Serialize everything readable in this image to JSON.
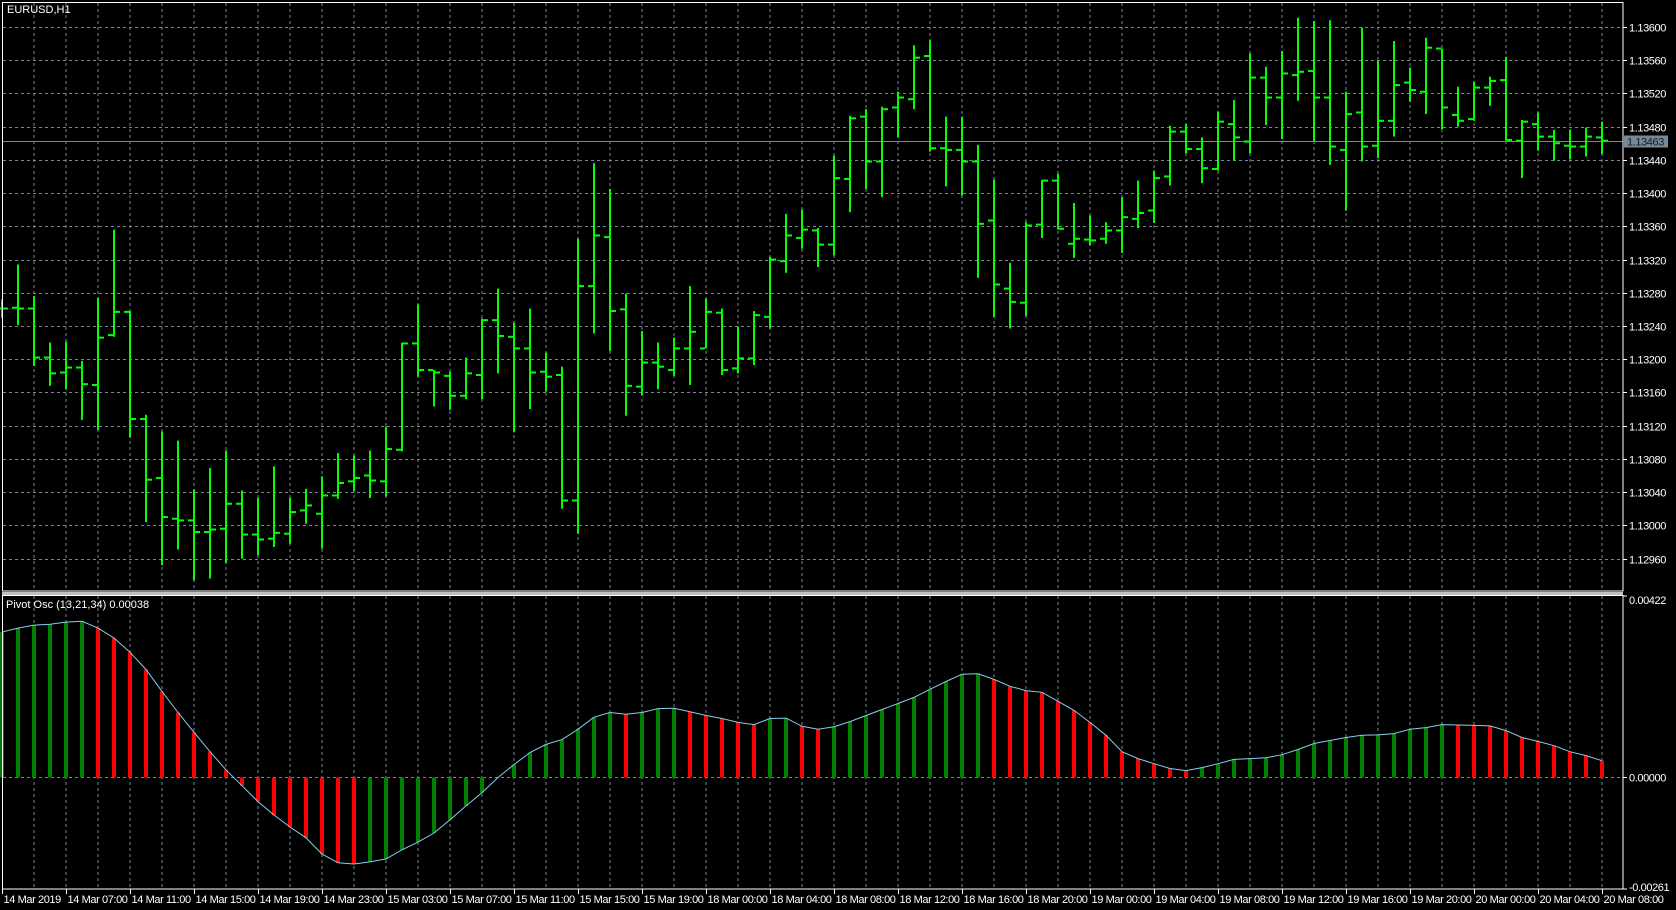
{
  "window": {
    "title": "EURUSD,H1"
  },
  "price_axis": {
    "labels": [
      "1.13600",
      "1.13560",
      "1.13520",
      "1.13480",
      "1.13440",
      "1.13400",
      "1.13360",
      "1.13320",
      "1.13280",
      "1.13240",
      "1.13200",
      "1.13160",
      "1.13120",
      "1.13080",
      "1.13040",
      "1.13000",
      "1.12960"
    ],
    "current_price": "1.13463"
  },
  "indicator": {
    "label": "Pivot Osc (13,21,34) 0.00038",
    "axis_labels": [
      "0.00422",
      "0.00000",
      "-0.00261"
    ]
  },
  "time_axis": {
    "labels": [
      "14 Mar 2019",
      "14 Mar 07:00",
      "14 Mar 11:00",
      "14 Mar 15:00",
      "14 Mar 19:00",
      "14 Mar 23:00",
      "15 Mar 03:00",
      "15 Mar 07:00",
      "15 Mar 11:00",
      "15 Mar 15:00",
      "15 Mar 19:00",
      "18 Mar 00:00",
      "18 Mar 04:00",
      "18 Mar 08:00",
      "18 Mar 12:00",
      "18 Mar 16:00",
      "18 Mar 20:00",
      "19 Mar 00:00",
      "19 Mar 04:00",
      "19 Mar 08:00",
      "19 Mar 12:00",
      "19 Mar 16:00",
      "19 Mar 20:00",
      "20 Mar 00:00",
      "20 Mar 04:00",
      "20 Mar 08:00"
    ]
  },
  "colors": {
    "background": "#000000",
    "bars": "#00ff00",
    "grid": "#778899",
    "osc_up": "#008000",
    "osc_down": "#ff0000",
    "osc_line": "#87ceeb",
    "current_price": "#778899"
  },
  "chart_data": [
    {
      "type": "ohlc",
      "symbol": "EURUSD",
      "timeframe": "H1",
      "ylim": [
        1.12921,
        1.1363
      ],
      "grid": true,
      "bars_ohlc": [
        [
          1.13261,
          1.13272,
          1.1325,
          1.13261
        ],
        [
          1.13262,
          1.13314,
          1.13241,
          1.13261
        ],
        [
          1.13261,
          1.13276,
          1.13192,
          1.13202
        ],
        [
          1.13202,
          1.1322,
          1.13168,
          1.13183
        ],
        [
          1.13184,
          1.13221,
          1.13164,
          1.1319
        ],
        [
          1.1319,
          1.13198,
          1.13127,
          1.1317
        ],
        [
          1.13169,
          1.13274,
          1.13115,
          1.13226
        ],
        [
          1.13229,
          1.13356,
          1.13227,
          1.13257
        ],
        [
          1.13257,
          1.13258,
          1.13106,
          1.13128
        ],
        [
          1.13128,
          1.13133,
          1.13004,
          1.13055
        ],
        [
          1.13057,
          1.13113,
          1.12952,
          1.1301
        ],
        [
          1.13008,
          1.13102,
          1.12971,
          1.13006
        ],
        [
          1.13006,
          1.13043,
          1.12934,
          1.12992
        ],
        [
          1.12992,
          1.13069,
          1.12936,
          1.12995
        ],
        [
          1.12996,
          1.1309,
          1.12955,
          1.13026
        ],
        [
          1.13026,
          1.13042,
          1.1296,
          1.12989
        ],
        [
          1.12989,
          1.13033,
          1.12964,
          1.12983
        ],
        [
          1.12984,
          1.13071,
          1.12974,
          1.12991
        ],
        [
          1.1299,
          1.13033,
          1.12978,
          1.13016
        ],
        [
          1.13018,
          1.13044,
          1.13002,
          1.13024
        ],
        [
          1.13014,
          1.13059,
          1.12972,
          1.13036
        ],
        [
          1.13036,
          1.13087,
          1.13032,
          1.13051
        ],
        [
          1.13053,
          1.13084,
          1.13041,
          1.13057
        ],
        [
          1.1306,
          1.1309,
          1.13033,
          1.13054
        ],
        [
          1.13053,
          1.13119,
          1.13035,
          1.13092
        ],
        [
          1.13091,
          1.1322,
          1.13089,
          1.13219
        ],
        [
          1.13219,
          1.13266,
          1.13179,
          1.13187
        ],
        [
          1.13187,
          1.13187,
          1.13143,
          1.13184
        ],
        [
          1.1318,
          1.13185,
          1.13139,
          1.13156
        ],
        [
          1.13156,
          1.13202,
          1.13152,
          1.13183
        ],
        [
          1.13181,
          1.13249,
          1.13152,
          1.13247
        ],
        [
          1.13247,
          1.13285,
          1.13183,
          1.13228
        ],
        [
          1.13227,
          1.13244,
          1.13112,
          1.13213
        ],
        [
          1.13213,
          1.13261,
          1.1314,
          1.13184
        ],
        [
          1.13185,
          1.13208,
          1.13161,
          1.13179
        ],
        [
          1.13181,
          1.13191,
          1.1302,
          1.1303
        ],
        [
          1.1303,
          1.13345,
          1.1299,
          1.13288
        ],
        [
          1.13288,
          1.13436,
          1.13231,
          1.13349
        ],
        [
          1.13347,
          1.13405,
          1.1321,
          1.13258
        ],
        [
          1.1326,
          1.13279,
          1.13132,
          1.13168
        ],
        [
          1.13167,
          1.13234,
          1.13157,
          1.13196
        ],
        [
          1.13196,
          1.1322,
          1.13164,
          1.13191
        ],
        [
          1.13187,
          1.13226,
          1.1318,
          1.13213
        ],
        [
          1.13213,
          1.13288,
          1.13169,
          1.13233
        ],
        [
          1.13213,
          1.13273,
          1.13213,
          1.13257
        ],
        [
          1.13256,
          1.13261,
          1.13181,
          1.13187
        ],
        [
          1.13189,
          1.13239,
          1.13183,
          1.13201
        ],
        [
          1.13201,
          1.13258,
          1.13193,
          1.13253
        ],
        [
          1.13251,
          1.13323,
          1.13237,
          1.1332
        ],
        [
          1.13318,
          1.13375,
          1.13304,
          1.13349
        ],
        [
          1.13346,
          1.1338,
          1.13333,
          1.13356
        ],
        [
          1.13355,
          1.13358,
          1.13311,
          1.13338
        ],
        [
          1.13338,
          1.13445,
          1.13325,
          1.13418
        ],
        [
          1.13417,
          1.13493,
          1.13377,
          1.1349
        ],
        [
          1.13492,
          1.13501,
          1.13405,
          1.13438
        ],
        [
          1.13438,
          1.13504,
          1.13395,
          1.13501
        ],
        [
          1.13503,
          1.13522,
          1.13467,
          1.13515
        ],
        [
          1.13513,
          1.13578,
          1.13501,
          1.13563
        ],
        [
          1.13565,
          1.13584,
          1.1345,
          1.13454
        ],
        [
          1.13454,
          1.13492,
          1.13408,
          1.13452
        ],
        [
          1.13452,
          1.13492,
          1.13397,
          1.13438
        ],
        [
          1.13438,
          1.13458,
          1.13298,
          1.13363
        ],
        [
          1.13367,
          1.13416,
          1.13251,
          1.1329
        ],
        [
          1.13285,
          1.13316,
          1.13237,
          1.13269
        ],
        [
          1.13268,
          1.13365,
          1.13252,
          1.13361
        ],
        [
          1.13362,
          1.13416,
          1.13346,
          1.13415
        ],
        [
          1.13415,
          1.13423,
          1.13356,
          1.13357
        ],
        [
          1.13339,
          1.13388,
          1.13322,
          1.13345
        ],
        [
          1.13344,
          1.13373,
          1.13337,
          1.13343
        ],
        [
          1.13345,
          1.13365,
          1.13339,
          1.13355
        ],
        [
          1.13355,
          1.13395,
          1.13328,
          1.13371
        ],
        [
          1.13369,
          1.13415,
          1.13358,
          1.13376
        ],
        [
          1.13379,
          1.13427,
          1.13364,
          1.13418
        ],
        [
          1.1342,
          1.13481,
          1.13409,
          1.13474
        ],
        [
          1.13474,
          1.13483,
          1.13448,
          1.13453
        ],
        [
          1.13453,
          1.13467,
          1.13412,
          1.1343
        ],
        [
          1.13429,
          1.13498,
          1.13427,
          1.13486
        ],
        [
          1.13483,
          1.13512,
          1.13439,
          1.13467
        ],
        [
          1.13462,
          1.13568,
          1.13448,
          1.13539
        ],
        [
          1.13539,
          1.13552,
          1.13482,
          1.13515
        ],
        [
          1.13515,
          1.13571,
          1.13465,
          1.13544
        ],
        [
          1.13542,
          1.13611,
          1.13511,
          1.13546
        ],
        [
          1.13547,
          1.13607,
          1.13462,
          1.13515
        ],
        [
          1.13515,
          1.13608,
          1.13434,
          1.13456
        ],
        [
          1.13452,
          1.13522,
          1.13379,
          1.13495
        ],
        [
          1.13497,
          1.13599,
          1.13438,
          1.13456
        ],
        [
          1.13457,
          1.13559,
          1.13442,
          1.13487
        ],
        [
          1.13487,
          1.13583,
          1.13468,
          1.1353
        ],
        [
          1.13533,
          1.13551,
          1.1351,
          1.13524
        ],
        [
          1.13522,
          1.13587,
          1.13495,
          1.13575
        ],
        [
          1.13574,
          1.13574,
          1.13477,
          1.13503
        ],
        [
          1.13494,
          1.13528,
          1.1348,
          1.13487
        ],
        [
          1.13489,
          1.13534,
          1.13487,
          1.13527
        ],
        [
          1.13527,
          1.1354,
          1.13505,
          1.13535
        ],
        [
          1.13536,
          1.13564,
          1.13463,
          1.13464
        ],
        [
          1.13463,
          1.13488,
          1.13418,
          1.13486
        ],
        [
          1.13483,
          1.13497,
          1.13451,
          1.13468
        ],
        [
          1.13468,
          1.13476,
          1.13439,
          1.1346
        ],
        [
          1.13457,
          1.13476,
          1.13441,
          1.13456
        ],
        [
          1.13456,
          1.13479,
          1.13444,
          1.13468
        ],
        [
          1.13467,
          1.13486,
          1.13447,
          1.13463
        ]
      ],
      "current_price": 1.13463
    },
    {
      "type": "bar",
      "name": "Pivot Osc (13,21,34)",
      "ylim": [
        -0.00261,
        0.00422
      ],
      "values": [
        0.00336,
        0.00345,
        0.00352,
        0.00354,
        0.00359,
        0.00361,
        0.00345,
        0.00322,
        0.00289,
        0.00249,
        0.00198,
        0.00149,
        0.00103,
        0.00058,
        0.00016,
        -0.00021,
        -0.00058,
        -0.00089,
        -0.00117,
        -0.00142,
        -0.0018,
        -0.002,
        -0.00203,
        -0.00198,
        -0.00191,
        -0.0017,
        -0.00152,
        -0.00131,
        -0.001,
        -0.00068,
        -0.00037,
        -2e-05,
        0.00028,
        0.00056,
        0.00075,
        0.00086,
        0.0011,
        0.00138,
        0.00149,
        0.00145,
        0.00149,
        0.00158,
        0.00159,
        0.00151,
        0.00142,
        0.00135,
        0.00126,
        0.00121,
        0.00135,
        0.00136,
        0.00117,
        0.0011,
        0.00116,
        0.00128,
        0.00142,
        0.00156,
        0.0017,
        0.00184,
        0.00203,
        0.00221,
        0.00238,
        0.00239,
        0.00226,
        0.0021,
        0.002,
        0.00196,
        0.00175,
        0.00154,
        0.00126,
        0.00096,
        0.00058,
        0.00042,
        0.0003,
        0.00019,
        0.00014,
        0.00021,
        0.0003,
        0.0004,
        0.00042,
        0.00044,
        0.00051,
        0.00063,
        0.00077,
        0.00084,
        0.00091,
        0.00096,
        0.00097,
        0.001,
        0.0011,
        0.00114,
        0.00121,
        0.0012,
        0.00119,
        0.00118,
        0.00107,
        0.00091,
        0.00082,
        0.00072,
        0.00058,
        0.00049,
        0.00037
      ]
    }
  ]
}
